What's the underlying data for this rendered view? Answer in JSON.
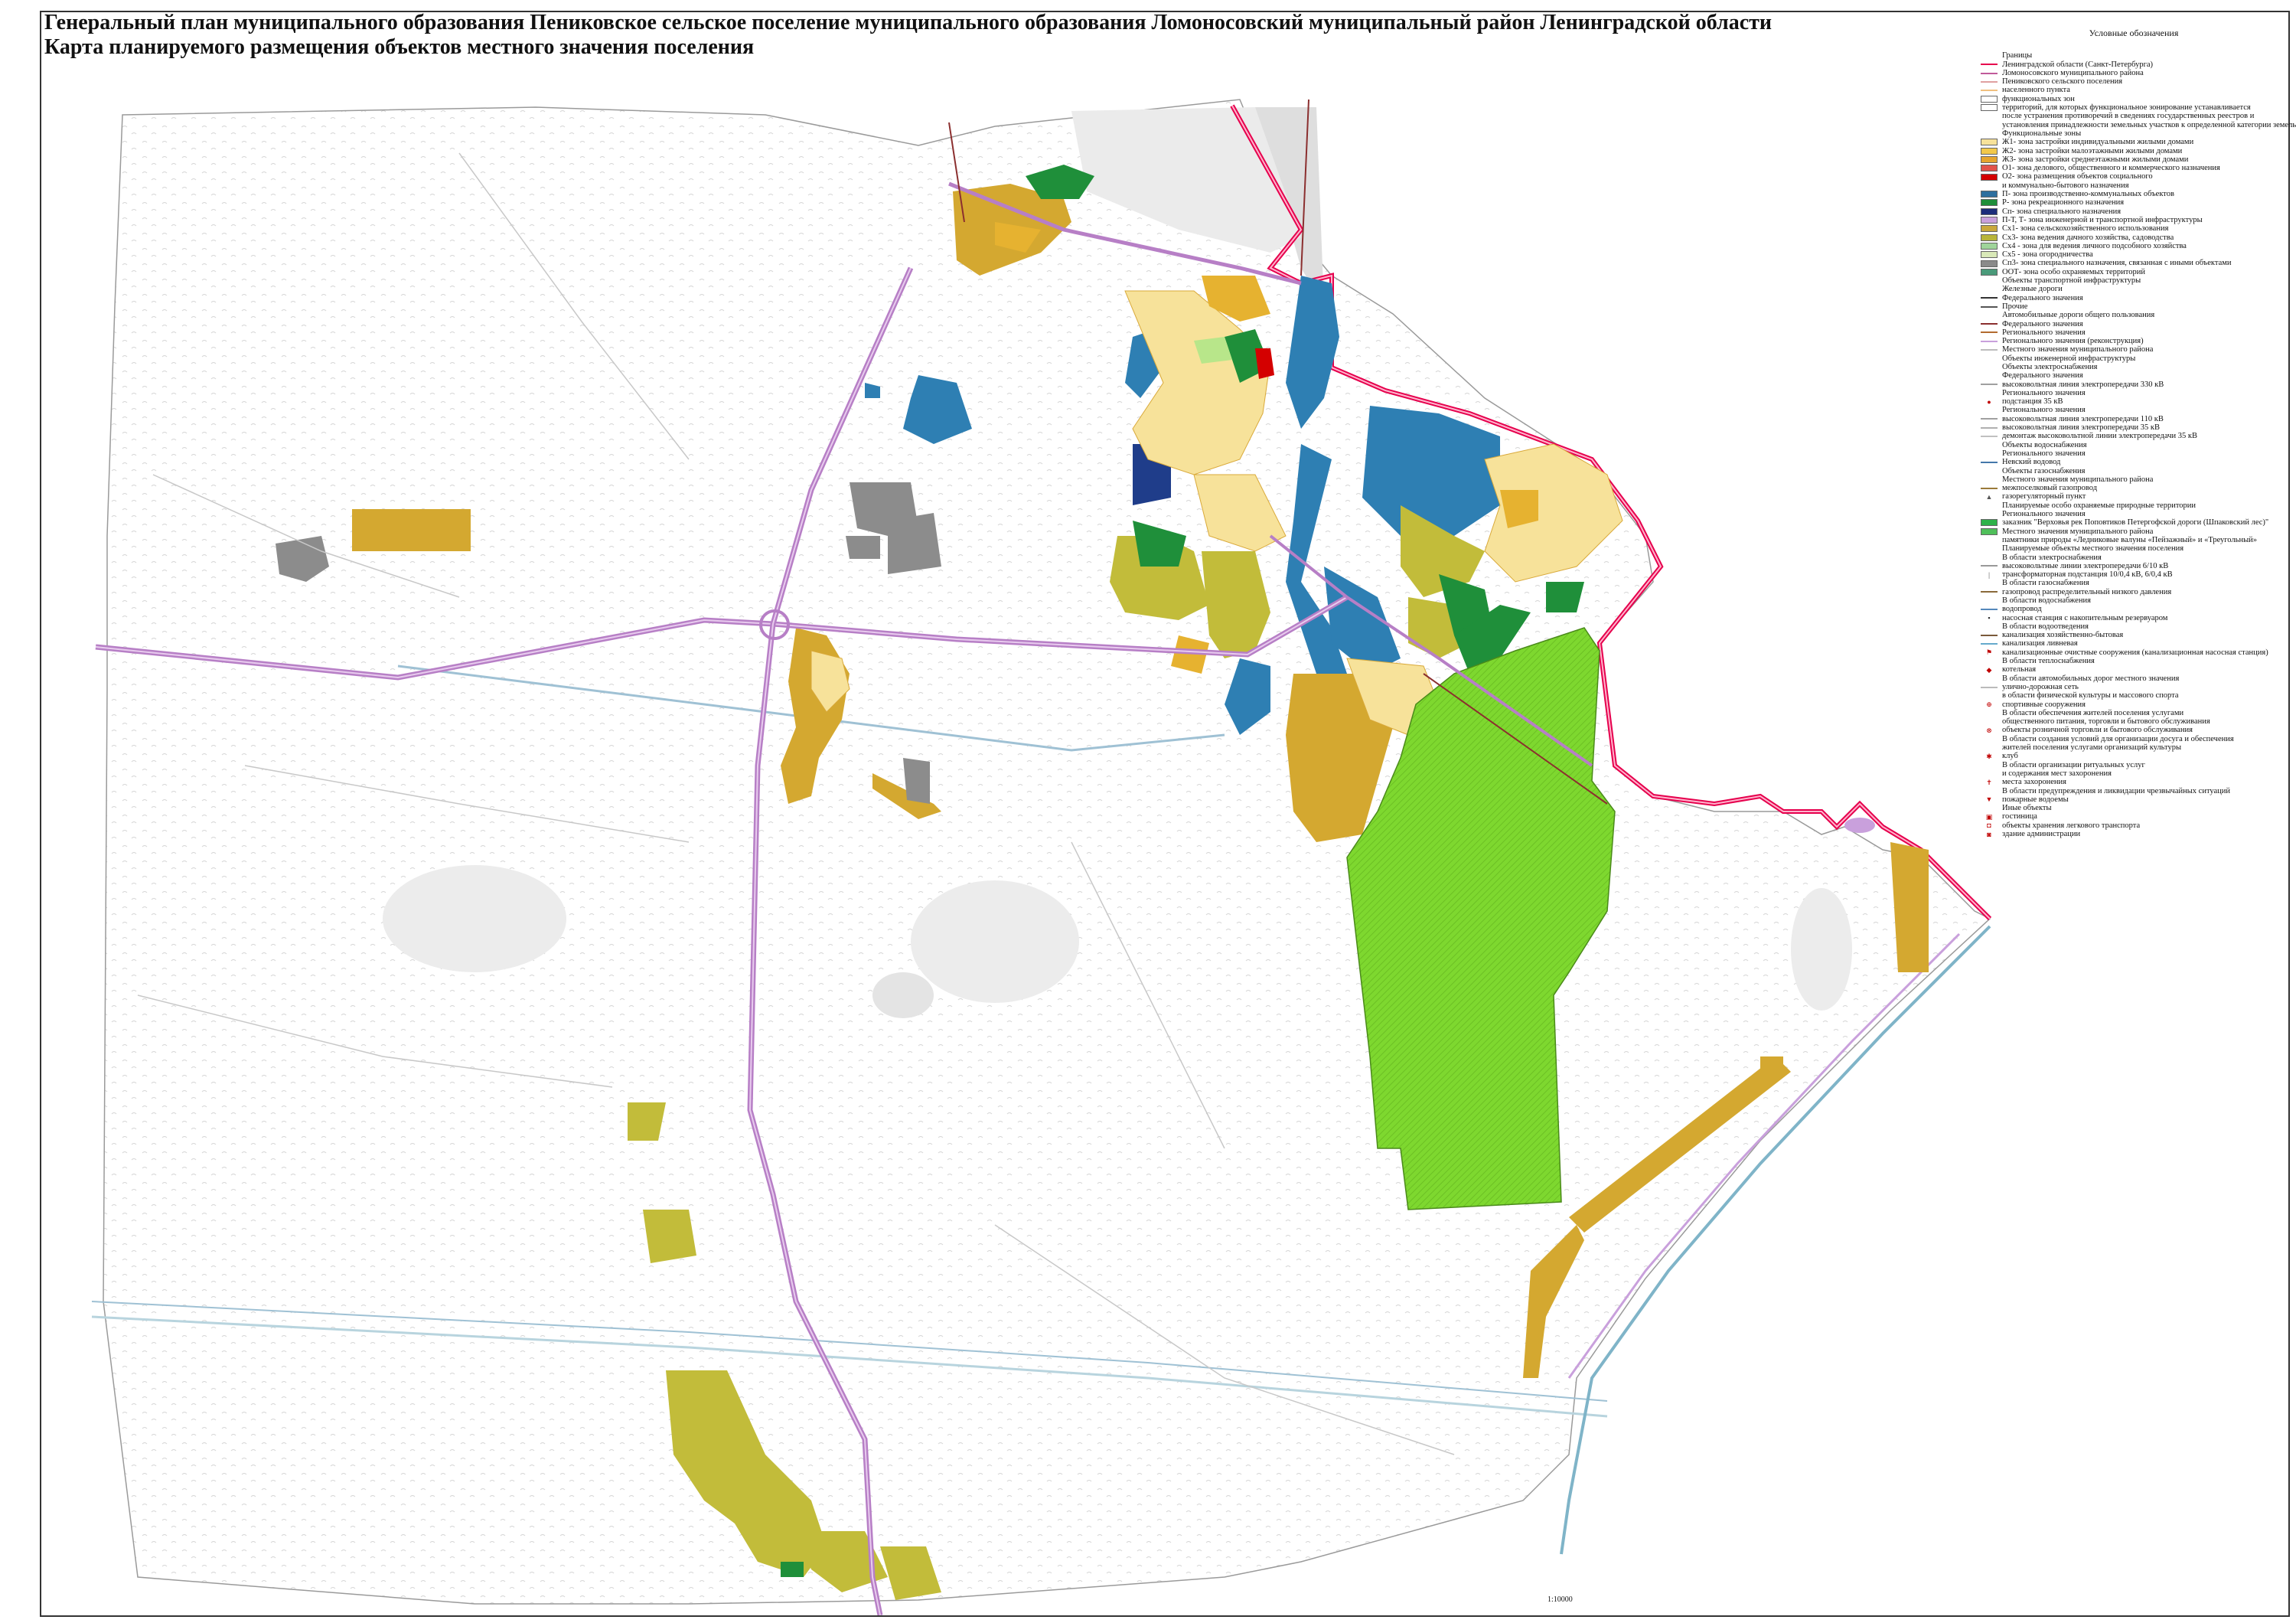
{
  "title": {
    "line1": "Генеральный план  муниципального образования Пениковское сельское поселение муниципального образования Ломоносовский муниципальный район Ленинградской области",
    "line2": "Карта планируемого размещения объектов местного значения поселения"
  },
  "legend": {
    "heading": "Условные обозначения",
    "rows": [
      {
        "kind": "text",
        "text": "Границы"
      },
      {
        "kind": "line",
        "color": "#e6004d",
        "text": "Ленинградской области (Санкт-Петербурга)"
      },
      {
        "kind": "line",
        "color": "#c05a9a",
        "text": "Ломоносовского муниципального района"
      },
      {
        "kind": "line",
        "color": "#e0a0a0",
        "text": "Пениковского сельского поселения"
      },
      {
        "kind": "line",
        "color": "#f0c080",
        "text": "населенного пункта"
      },
      {
        "kind": "swatch",
        "color": "#ffffff",
        "text": "функциональных зон"
      },
      {
        "kind": "swatch",
        "color": "#ffffff",
        "text": "территорий, для которых функциональное зонирование устанавливается"
      },
      {
        "kind": "text",
        "text": "после устранения противоречий в сведениях государственных реестров и"
      },
      {
        "kind": "text",
        "text": "установления принадлежности земельных участков к определенной категории земель"
      },
      {
        "kind": "text",
        "text": "Функциональные зоны"
      },
      {
        "kind": "swatch",
        "color": "#f7e29a",
        "text": "Ж1- зона застройки индивидуальными жилыми домами"
      },
      {
        "kind": "swatch",
        "color": "#f2c84a",
        "text": "Ж2- зона застройки малоэтажными жилыми домами"
      },
      {
        "kind": "swatch",
        "color": "#e6a52e",
        "text": "Ж3- зона застройки среднеэтажными жилыми домами"
      },
      {
        "kind": "swatch",
        "color": "#e2534a",
        "text": "О1- зона делового, общественного и коммерческого назначения"
      },
      {
        "kind": "swatch",
        "color": "#d40000",
        "text": "О2- зона размещения объектов социального"
      },
      {
        "kind": "text",
        "text": "и коммунально-бытового назначения"
      },
      {
        "kind": "swatch",
        "color": "#2e6f9e",
        "text": "П- зона производственно-коммунальных объектов"
      },
      {
        "kind": "swatch",
        "color": "#1f8f3a",
        "text": "Р- зона рекреационного назначения"
      },
      {
        "kind": "swatch",
        "color": "#1c2d7a",
        "text": "Сп- зона специального назначения"
      },
      {
        "kind": "swatch",
        "color": "#c9a0dc",
        "text": "П-Т, Т- зона инженерной и транспортной инфраструктуры"
      },
      {
        "kind": "swatch",
        "color": "#c9a83c",
        "text": "Сх1- зона сельскохозяйственного использования"
      },
      {
        "kind": "swatch",
        "color": "#b8b43a",
        "text": "Сх3- зона ведения дачного хозяйства, садоводства"
      },
      {
        "kind": "swatch",
        "color": "#9fd49a",
        "text": "Сх4 - зона для ведения личного подсобного хозяйства"
      },
      {
        "kind": "swatch",
        "color": "#d9e9b8",
        "text": "Сх5 - зона огородничества"
      },
      {
        "kind": "swatch",
        "color": "#8a8a8a",
        "text": "Сп3- зона специального назначения, связанная с иными объектами"
      },
      {
        "kind": "swatch",
        "color": "#4a9a7a",
        "text": "ООТ- зона особо охраняемых  территорий"
      },
      {
        "kind": "text",
        "text": "Объекты транспортной инфраструктуры"
      },
      {
        "kind": "text",
        "text": "Железные дороги"
      },
      {
        "kind": "line",
        "color": "#333333",
        "text": "Федерального значения"
      },
      {
        "kind": "line",
        "color": "#555555",
        "text": "Прочие"
      },
      {
        "kind": "text",
        "text": "Автомобильные дороги общего пользования"
      },
      {
        "kind": "line",
        "color": "#8b2f2f",
        "text": "Федерального значения"
      },
      {
        "kind": "line",
        "color": "#b36b2f",
        "text": "Регионального значения"
      },
      {
        "kind": "line",
        "color": "#c9a0dc",
        "text": "Регионального значения (реконструкция)"
      },
      {
        "kind": "line",
        "color": "#bcbcbc",
        "text": "Местного значения муниципального района"
      },
      {
        "kind": "text",
        "text": "Объекты инженерной инфраструктуры"
      },
      {
        "kind": "text",
        "text": "Объекты электроснабжения"
      },
      {
        "kind": "text",
        "text": "Федерального значения"
      },
      {
        "kind": "line",
        "color": "#a0a0a0",
        "text": "высоковольтная линия электропередачи 330 кВ"
      },
      {
        "kind": "text",
        "text": "Регионального значения"
      },
      {
        "kind": "icon",
        "glyph": "●",
        "color": "#c00000",
        "text": "подстанция 35 кВ"
      },
      {
        "kind": "text",
        "text": "Регионального значения"
      },
      {
        "kind": "line",
        "color": "#a0a0a0",
        "text": "высоковольтная линия электропередачи 110 кВ"
      },
      {
        "kind": "line",
        "color": "#b0b0b0",
        "text": "высоковольтная линия электропередачи 35 кВ"
      },
      {
        "kind": "line",
        "color": "#c0c0c0",
        "text": "демонтаж высоковольтной линии электропередачи 35 кВ"
      },
      {
        "kind": "text",
        "text": "Объекты водоснабжения"
      },
      {
        "kind": "text",
        "text": "Регионального значения"
      },
      {
        "kind": "line",
        "color": "#4477aa",
        "text": "Невский водовод"
      },
      {
        "kind": "text",
        "text": "Объекты газоснабжения"
      },
      {
        "kind": "text",
        "text": "Местного значения муниципального района"
      },
      {
        "kind": "line",
        "color": "#9a7a3a",
        "text": "межпоселковый газопровод"
      },
      {
        "kind": "icon",
        "glyph": "▲",
        "color": "#555555",
        "text": "газорегуляторный пункт"
      },
      {
        "kind": "text",
        "text": "Планируемые особо охраняемые природные территории"
      },
      {
        "kind": "text",
        "text": "Регионального значения"
      },
      {
        "kind": "swatch",
        "color": "#2fb24a",
        "text": "заказник \"Верховья рек Поповтиков Петергофской дороги (Шпаковский лес)\""
      },
      {
        "kind": "swatch",
        "color": "#4fbf5a",
        "text": "Местного значения муниципального района"
      },
      {
        "kind": "text",
        "text": "памятники природы «Ледниковые валуны «Пейзажный» и «Треугольный»"
      },
      {
        "kind": "text",
        "text": "Планируемые объекты местного значения поселения"
      },
      {
        "kind": "text",
        "text": "В области электроснабжения"
      },
      {
        "kind": "line",
        "color": "#999999",
        "text": "высоковольтные линии электропередачи 6/10 кВ"
      },
      {
        "kind": "icon",
        "glyph": "|",
        "color": "#333333",
        "text": "трансформаторная подстанция 10/0,4 кВ, 6/0,4 кВ"
      },
      {
        "kind": "text",
        "text": "В области газоснабжения"
      },
      {
        "kind": "line",
        "color": "#8a6a3a",
        "text": "газопровод распределительный низкого давления"
      },
      {
        "kind": "text",
        "text": "В области водоснабжения"
      },
      {
        "kind": "line",
        "color": "#5588bb",
        "text": "водопровод"
      },
      {
        "kind": "icon",
        "glyph": "▪",
        "color": "#333333",
        "text": "насосная станция с накопительным резервуаром"
      },
      {
        "kind": "text",
        "text": "В области водоотведения"
      },
      {
        "kind": "line",
        "color": "#7a5a3a",
        "text": "канализация хозяйственно-бытовая"
      },
      {
        "kind": "line",
        "color": "#66aacc",
        "text": "канализация ливневая"
      },
      {
        "kind": "icon",
        "glyph": "⚑",
        "color": "#c00000",
        "text": "канализационные очистные сооружения (канализационная насосная станция)"
      },
      {
        "kind": "text",
        "text": "В области теплоснабжения"
      },
      {
        "kind": "icon",
        "glyph": "◆",
        "color": "#c00000",
        "text": "котельная"
      },
      {
        "kind": "text",
        "text": "В области автомобильных дорог местного значения"
      },
      {
        "kind": "line",
        "color": "#bbbbbb",
        "text": "улично-дорожная сеть"
      },
      {
        "kind": "text",
        "text": "в области физической культуры и массового спорта"
      },
      {
        "kind": "icon",
        "glyph": "⊕",
        "color": "#c00000",
        "text": "спортивные сооружения"
      },
      {
        "kind": "text",
        "text": "В области обеспечения жителей поселения услугами"
      },
      {
        "kind": "text",
        "text": "общественного питания, торговли и бытового обслуживания"
      },
      {
        "kind": "icon",
        "glyph": "⊗",
        "color": "#c00000",
        "text": "объекты розничной торговли и бытового обслуживания"
      },
      {
        "kind": "text",
        "text": "В области создания условий для организации досуга и обеспечения"
      },
      {
        "kind": "text",
        "text": "жителей поселения услугами организаций культуры"
      },
      {
        "kind": "icon",
        "glyph": "✱",
        "color": "#c00000",
        "text": "клуб"
      },
      {
        "kind": "text",
        "text": "В области  организации ритуальных услуг"
      },
      {
        "kind": "text",
        "text": "и содержания мест захоронения"
      },
      {
        "kind": "icon",
        "glyph": "✝",
        "color": "#c00000",
        "text": "места захоронения"
      },
      {
        "kind": "text",
        "text": "В области  предупреждения и ликвидации чрезвычайных ситуаций"
      },
      {
        "kind": "icon",
        "glyph": "▼",
        "color": "#c00000",
        "text": "пожарные водоемы"
      },
      {
        "kind": "text",
        "text": "Иные объекты"
      },
      {
        "kind": "icon",
        "glyph": "▣",
        "color": "#c00000",
        "text": "гостиница"
      },
      {
        "kind": "icon",
        "glyph": "◘",
        "color": "#c00000",
        "text": "объекты хранения легкового транспорта"
      },
      {
        "kind": "icon",
        "glyph": "◙",
        "color": "#c00000",
        "text": "здание администрации"
      }
    ]
  },
  "scale_text": "1:10000",
  "colors": {
    "boundary_region": "#e6004d",
    "boundary_district": "#c05a9a",
    "zone_blue": "#2e7fb3",
    "zone_gold": "#d4a830",
    "zone_olive": "#c2bc3a",
    "zone_green_bright": "#7ed82f",
    "zone_green_dark": "#1f8f3a",
    "zone_yellow": "#f7e29a",
    "zone_grey": "#8c8c8c",
    "road_purple": "#b77fc6",
    "water_grey": "#dedede"
  }
}
